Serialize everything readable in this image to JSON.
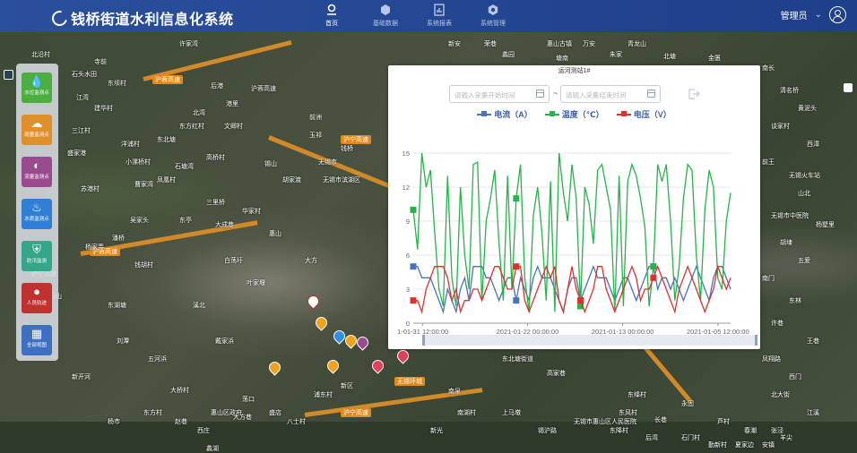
{
  "header": {
    "app_title": "钱桥街道水利信息化系统",
    "nav": [
      {
        "label": "首页",
        "icon": "home-pin-icon",
        "active": true
      },
      {
        "label": "基础数据",
        "icon": "cube-icon",
        "active": false
      },
      {
        "label": "系统报表",
        "icon": "report-icon",
        "active": false
      },
      {
        "label": "系统管理",
        "icon": "settings-icon",
        "active": false
      }
    ],
    "user_label": "管理员"
  },
  "sidebar": {
    "items": [
      {
        "label": "水位监测点",
        "icon": "water-drop-icon",
        "color": "#4cae3e"
      },
      {
        "label": "雨量监测点",
        "icon": "rain-cloud-icon",
        "color": "#e0902a"
      },
      {
        "label": "流量监测点",
        "icon": "flow-gauge-icon",
        "color": "#9a4a8e"
      },
      {
        "label": "水质监测点",
        "icon": "water-quality-icon",
        "color": "#2f7fd6"
      },
      {
        "label": "防汛监测",
        "icon": "shield-icon",
        "color": "#34a78b"
      },
      {
        "label": "人员轨迹",
        "icon": "person-track-icon",
        "color": "#c0322f"
      },
      {
        "label": "全部视图",
        "icon": "grid-view-icon",
        "color": "#3f6fc1"
      }
    ]
  },
  "map": {
    "labels": [
      "许家湾",
      "北沿村",
      "石头水田",
      "寺前",
      "东坝村",
      "江湾",
      "建华村",
      "三江村",
      "盛家港",
      "小漯桥村",
      "苏港村",
      "曹家湾",
      "洋浦村",
      "后港",
      "港里",
      "北湾",
      "东方红村",
      "东北塘",
      "沪蓉高速",
      "文卿村",
      "惠山",
      "白荡圩",
      "叶家堰",
      "大方",
      "无锡市",
      "无锡市滨湖区",
      "胡家渡",
      "前洲",
      "玉祁",
      "钱桥",
      "锡山",
      "高桥村",
      "石塘湾",
      "凤凰村",
      "东亭",
      "三里桥",
      "大成巷",
      "华家村",
      "吴家头",
      "潘桥",
      "杨家弄",
      "钱胡村",
      "东湖塘",
      "沪宁高速",
      "马山",
      "葛埭",
      "新开河",
      "刘潭",
      "五河浜",
      "溪北",
      "戴家浜",
      "大桥村",
      "东方村",
      "杨市",
      "赵巷",
      "惠山区政府",
      "荡口",
      "盛店",
      "浦东村",
      "新区",
      "八士村",
      "大方巷",
      "西庄",
      "蠡湖",
      "南长",
      "清名桥",
      "黄泥头",
      "谈家村",
      "西漳",
      "前王",
      "无锡火车站",
      "山北",
      "无锡市中医院",
      "杨墅里",
      "胡埭",
      "五爱",
      "南门",
      "东林",
      "许巷",
      "王巷",
      "凤翔路",
      "西门",
      "北大街",
      "江溪",
      "张泾",
      "新安",
      "荣巷",
      "惠山古镇",
      "万安",
      "青龙山",
      "蠡园",
      "塘南",
      "朱家",
      "北塘",
      "金匮",
      "东北塘街道",
      "高家巷",
      "南泉",
      "东绛村",
      "永固",
      "东风村",
      "长巷",
      "无锡市惠山区人民医院",
      "锡沪路",
      "南湖村",
      "上马墩",
      "芦村",
      "春潮",
      "新光",
      "东降村",
      "后湾",
      "石门村",
      "勤新村",
      "夏家边",
      "安镇",
      "羊尖"
    ],
    "highways": [
      "沪宁高速",
      "沪蓉高速",
      "无锡环城"
    ]
  },
  "popup": {
    "title": "运河测站1#",
    "start_placeholder": "请输入采集开始时间",
    "end_placeholder": "请输入采集结束时间",
    "separator": "~",
    "export_icon": "export-icon"
  },
  "chart_data": {
    "type": "line",
    "title": "运河测站1#",
    "x_tick_labels": [
      "1-01-31 12:00:00",
      "2021-01-22 00:00:00",
      "2021-01-13 00:00:00",
      "2021-01-05 12:00:00"
    ],
    "y_ticks": [
      0,
      3,
      6,
      9,
      12,
      15
    ],
    "ylim": [
      0,
      15
    ],
    "grid": true,
    "legend_position": "top-center",
    "series": [
      {
        "name": "电流（A）",
        "color": "#4a73b5",
        "values": [
          5,
          5,
          4,
          4,
          4,
          3,
          2,
          1,
          3,
          2,
          1,
          3,
          4,
          2,
          5,
          5,
          5,
          4,
          4,
          3,
          2,
          3,
          4,
          4,
          2,
          4,
          3,
          2,
          4,
          5,
          4,
          4,
          4,
          3,
          2,
          1,
          3,
          4,
          4,
          2,
          3,
          4,
          5,
          4,
          4,
          4,
          3,
          2,
          3,
          4,
          4,
          3,
          2,
          3,
          4,
          5,
          5,
          3,
          4,
          4,
          3,
          4,
          3,
          2,
          3,
          4,
          5,
          4,
          3,
          2,
          4,
          5,
          5,
          4,
          3
        ]
      },
      {
        "name": "温度（℃）",
        "color": "#27b34a",
        "values": [
          10,
          6.5,
          15,
          12,
          13.5,
          8,
          3,
          1.5,
          13,
          4,
          1.5,
          12,
          6,
          3,
          14,
          14.2,
          2,
          9,
          11,
          13.5,
          7,
          2,
          13,
          3,
          11,
          14,
          4,
          1,
          9.5,
          12,
          8,
          2,
          12.5,
          1,
          15,
          11.5,
          9,
          14,
          11,
          1.5,
          12,
          10.5,
          7,
          13.5,
          14,
          12,
          10,
          1,
          13,
          1.5,
          12.5,
          14,
          13,
          11,
          8.5,
          1.5,
          5,
          14,
          12.5,
          14,
          9,
          2,
          5,
          11,
          14,
          13.5,
          6,
          2,
          10,
          13.5,
          12,
          4,
          3,
          9,
          11.5
        ]
      },
      {
        "name": "电压（V）",
        "color": "#e0302e",
        "values": [
          2,
          2,
          1,
          3,
          4,
          5,
          5,
          5,
          4,
          2,
          3,
          1,
          2,
          2,
          3,
          3,
          2,
          3,
          4,
          5,
          5,
          4,
          3,
          3,
          5,
          5,
          2,
          1,
          2,
          3,
          4,
          5,
          4,
          5,
          2,
          1,
          3,
          5,
          3,
          2,
          1,
          2,
          3,
          5,
          5,
          3,
          2,
          1,
          2,
          3,
          4,
          5,
          4,
          2,
          3,
          3,
          4,
          5,
          4,
          3,
          2,
          1,
          3,
          4,
          5,
          4,
          3,
          2,
          1,
          2,
          3,
          5,
          4,
          3,
          4
        ]
      }
    ]
  }
}
